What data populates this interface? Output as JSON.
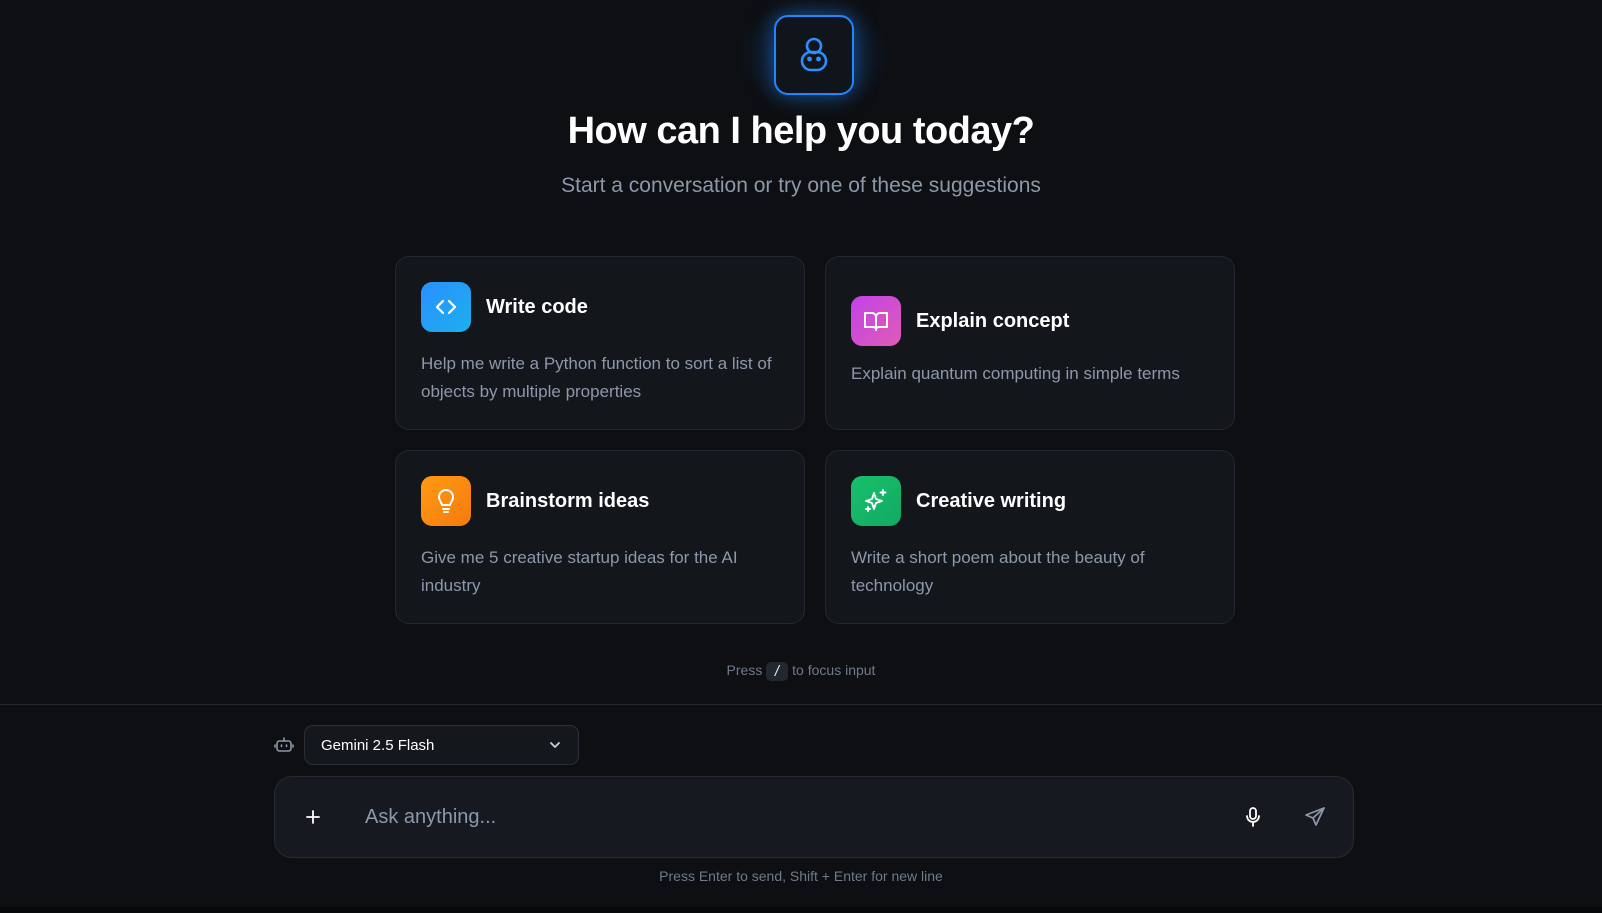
{
  "hero": {
    "logo_icon": "robot-icon",
    "title": "How can I help you today?",
    "subtitle": "Start a conversation or try one of these suggestions"
  },
  "suggestions": [
    {
      "icon": "code-icon",
      "color": "#2b8fff",
      "title": "Write code",
      "description": "Help me write a Python function to sort a list of objects by multiple properties"
    },
    {
      "icon": "book-icon",
      "color": "#c143e8",
      "title": "Explain concept",
      "description": "Explain quantum computing in simple terms"
    },
    {
      "icon": "lightbulb-icon",
      "color": "#ff9a10",
      "title": "Brainstorm ideas",
      "description": "Give me 5 creative startup ideas for the AI industry"
    },
    {
      "icon": "sparkles-icon",
      "color": "#18c06c",
      "title": "Creative writing",
      "description": "Write a short poem about the beauty of technology"
    }
  ],
  "shortcut_hint": {
    "prefix": "Press",
    "key": "/",
    "suffix": "to focus input"
  },
  "composer": {
    "model_icon": "bot-icon",
    "model": "Gemini 2.5 Flash",
    "placeholder": "Ask anything...",
    "footer": "Press Enter to send, Shift + Enter for new line"
  },
  "colors": {
    "accent": "#1f86ff",
    "background": "#0d0f12"
  }
}
